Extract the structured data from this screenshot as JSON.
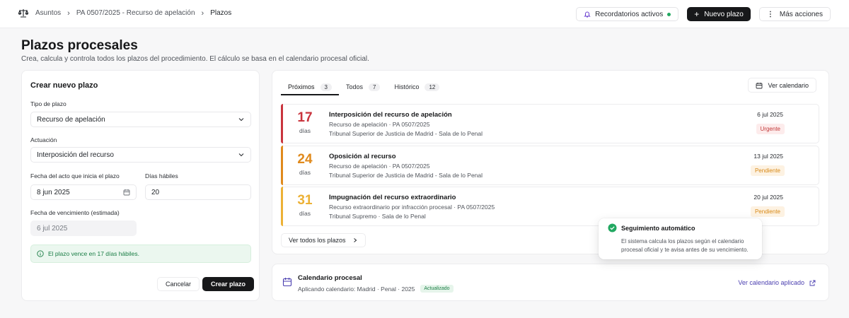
{
  "breadcrumb": {
    "items": [
      "Asuntos",
      "PA 0507/2025 - Recurso de apelación",
      "Plazos"
    ]
  },
  "topbar": {
    "reminders_label": "Recordatorios activos",
    "new_label": "Nuevo plazo",
    "more_label": "Más acciones"
  },
  "header": {
    "title": "Plazos procesales",
    "subtitle": "Crea, calcula y controla todos los plazos del procedimiento. El cálculo se basa en el calendario procesal oficial."
  },
  "form": {
    "title": "Crear nuevo plazo",
    "type_label": "Tipo de plazo",
    "type_value": "Recurso de apelación",
    "action_label": "Actuación",
    "action_value": "Interposición del recurso",
    "date_label": "Fecha del acto que inicia el plazo",
    "date_value": "8 jun 2025",
    "days_label": "Días hábiles",
    "days_value": "20",
    "due_label": "Fecha de vencimiento (estimada)",
    "due_value": "6 jul 2025",
    "info": "El plazo vence en 17 días hábiles.",
    "cancel": "Cancelar",
    "create": "Crear plazo"
  },
  "tabs": [
    {
      "label": "Próximos",
      "count": "3"
    },
    {
      "label": "Todos",
      "count": "7"
    },
    {
      "label": "Histórico",
      "count": "12"
    }
  ],
  "view_calendar": "Ver calendario",
  "deadlines": [
    {
      "days": "17",
      "days_label": "días",
      "title": "Interposición del recurso de apelación",
      "line1": "Recurso de apelación   · PA 0507/2025",
      "line2": "Tribunal Superior de Justicia de Madrid - Sala de lo Penal",
      "date": "6 jul 2025",
      "badge": "Urgente",
      "color": "#c9343d"
    },
    {
      "days": "24",
      "days_label": "días",
      "title": "Oposición al recurso",
      "line1": "Recurso de apelación   · PA 0507/2025",
      "line2": "Tribunal Superior de Justicia de Madrid - Sala de lo Penal",
      "date": "13 jul 2025",
      "badge": "Pendiente",
      "color": "#e08a1c"
    },
    {
      "days": "31",
      "days_label": "días",
      "title": "Impugnación del recurso extraordinario",
      "line1": "Recurso extraordinario por infracción procesal · PA 0507/2025",
      "line2": "Tribunal Supremo   · Sala de lo Penal",
      "date": "20 jul 2025",
      "badge": "Pendiente",
      "color": "#ecb135"
    }
  ],
  "see_all": "Ver todos los plazos",
  "calendar": {
    "title": "Calendario procesal",
    "subtitle": "Aplicando calendario: Madrid · Penal · 2025",
    "badge": "Actualizado",
    "link": "Ver calendario aplicado"
  },
  "toast": {
    "title": "Seguimiento automático",
    "body": "El sistema calcula los plazos según el calendario procesal oficial y te avisa antes de su vencimiento."
  }
}
